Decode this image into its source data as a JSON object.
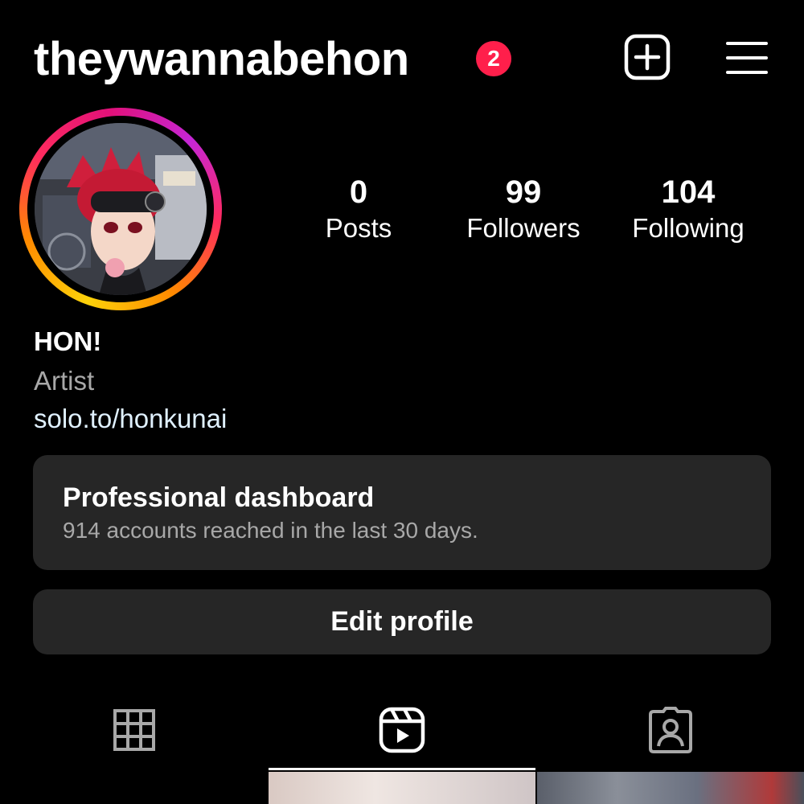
{
  "header": {
    "username": "theywannabehon",
    "notification_count": "2"
  },
  "profile": {
    "stats": [
      {
        "value": "0",
        "label": "Posts"
      },
      {
        "value": "99",
        "label": "Followers"
      },
      {
        "value": "104",
        "label": "Following"
      }
    ],
    "display_name": "HON!",
    "category": "Artist",
    "link": "solo.to/honkunai"
  },
  "dashboard": {
    "title": "Professional dashboard",
    "subtitle": "914 accounts reached in the last 30 days."
  },
  "edit_profile_label": "Edit profile",
  "tabs": {
    "items": [
      "grid-icon",
      "reels-icon",
      "tagged-icon"
    ],
    "active": "reels-icon"
  },
  "colors": {
    "badge": "#ff1f4b",
    "card": "#262626",
    "secondary_text": "#a8a8a8",
    "link_text": "#e0f1ff"
  }
}
